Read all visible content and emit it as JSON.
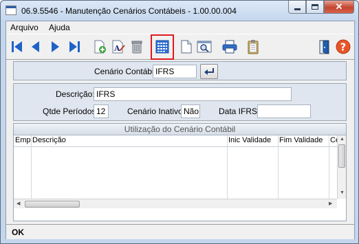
{
  "window": {
    "title": "06.9.5546 - Manutenção Cenários Contábeis - 1.00.00.004",
    "close_glyph": "✕"
  },
  "menu": {
    "items": [
      "Arquivo",
      "Ajuda"
    ]
  },
  "toolbar": {
    "icons": [
      "first-icon",
      "previous-icon",
      "next-icon",
      "last-icon",
      "new-record-icon",
      "edit-icon",
      "delete-icon",
      "calendar-grid-icon",
      "document-icon",
      "preview-icon",
      "print-icon",
      "clipboard-icon",
      "exit-door-icon",
      "help-icon"
    ],
    "highlighted": "calendar-grid-icon"
  },
  "filter": {
    "cenario_label": "Cenário Contábil:",
    "cenario_value": "IFRS"
  },
  "details": {
    "descricao_label": "Descrição:",
    "descricao_value": "IFRS",
    "qtde_label": "Qtde Períodos:",
    "qtde_value": "12",
    "inativo_label": "Cenário Inativo:",
    "inativo_value": "Não",
    "data_ifrs_label": "Data IFRS:",
    "data_ifrs_value": ""
  },
  "grid": {
    "title": "Utilização do Cenário Contábil",
    "columns": [
      "Emp",
      "Descrição",
      "Inic Validade",
      "Fim Validade",
      "Ce"
    ],
    "rows": []
  },
  "status": {
    "text": "OK"
  },
  "colors": {
    "highlight": "#e0181a",
    "accent": "#2c5fa8"
  }
}
